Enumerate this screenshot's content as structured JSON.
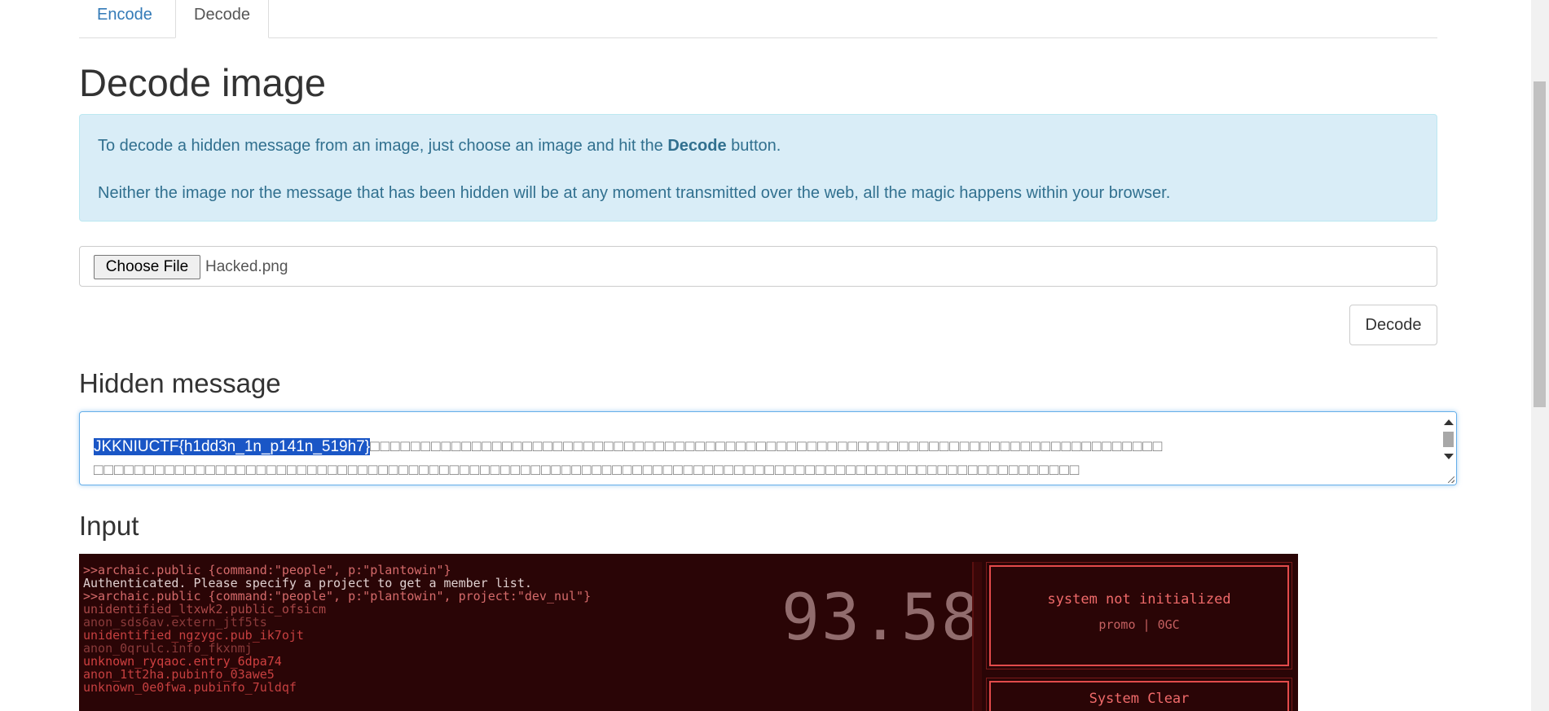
{
  "tabs": [
    {
      "label": "Encode",
      "active": false
    },
    {
      "label": "Decode",
      "active": true
    }
  ],
  "page_title": "Decode image",
  "info": {
    "line1_before": "To decode a hidden message from an image, just choose an image and hit the ",
    "line1_bold": "Decode",
    "line1_after": " button.",
    "line2": "Neither the image nor the message that has been hidden will be at any moment transmitted over the web, all the magic happens within your browser."
  },
  "file_input": {
    "button_label": "Choose File",
    "file_name": "Hacked.png"
  },
  "decode_button": "Decode",
  "hidden_message": {
    "heading": "Hidden message",
    "selected_text": "JKKNIUCTF{h1dd3n_1n_p141n_519h7}",
    "rest_line1": "□□□□□□□□□□□□□□□□□□□□□□□□□□□□□□□□□□□□□□□□□□□□□□□□□□□□□□□□□□□□□□□□□□□□□□□□□□□□□□",
    "line2": "□□□□□□□□□□□□□□□□□□□□□□□□□□□□□□□□□□□□□□□□□□□□□□□□□□□□□□□□□□□□□□□□□□□□□□□□□□□□□□□□□□□□□□□□□□□□□□□□□"
  },
  "input_section": {
    "heading": "Input",
    "image": {
      "terminal_lines": [
        ">>archaic.public {command:\"people\", p:\"plantowin\"}",
        "Authenticated. Please specify a project to get a member list.",
        "",
        ">>archaic.public {command:\"people\", p:\"plantowin\", project:\"dev_nul\"}",
        "unidentified_ltxwk2.public_ofsicm",
        "anon_sds6av.extern_jtf5ts",
        "unidentified_ngzygc.pub_ik7ojt",
        "anon_0qrulc.info_fkxnmj",
        "unknown_ryqaoc.entry_6dpa74",
        "anon_1tt2ha.pubinfo_03awe5",
        "unknown_0e0fwa.pubinfo_7uldqf"
      ],
      "big_number": "93.58",
      "panel1_title": "system not initialized",
      "panel1_sub": "promo | 0GC",
      "panel2_title": "System Clear"
    }
  }
}
